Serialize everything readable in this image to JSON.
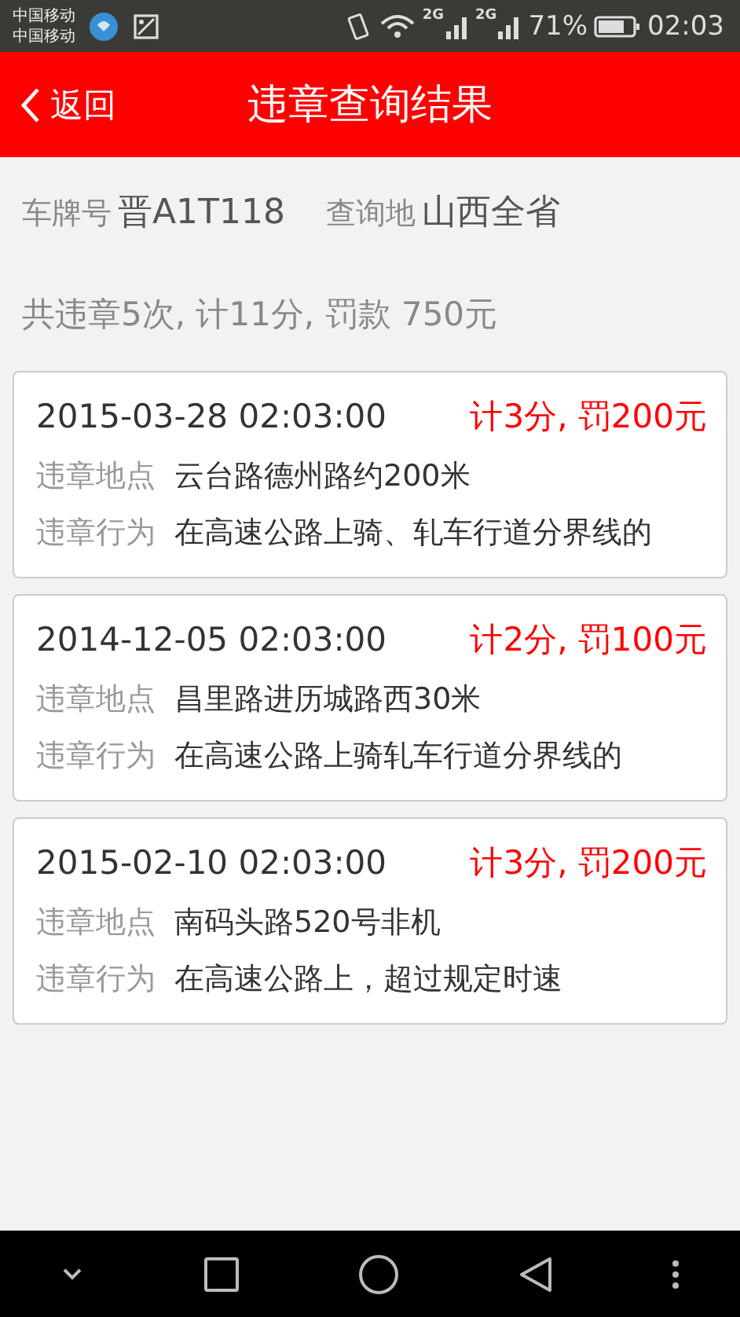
{
  "status_bar": {
    "carriers": [
      "中国移动",
      "中国移动"
    ],
    "network_1": "2G",
    "network_2": "2G",
    "battery": "71%",
    "time": "02:03"
  },
  "header": {
    "back": "返回",
    "title": "违章查询结果"
  },
  "query": {
    "plate_label": "车牌号",
    "plate": "晋A1T118",
    "region_label": "查询地",
    "region": "山西全省"
  },
  "summary": "共违章5次, 计11分, 罚款 750元",
  "records": [
    {
      "time": "2015-03-28 02:03:00",
      "penalty": "计3分, 罚200元",
      "location_label": "违章地点",
      "location": "云台路德州路约200米",
      "action_label": "违章行为",
      "action": "在高速公路上骑、轧车行道分界线的"
    },
    {
      "time": "2014-12-05 02:03:00",
      "penalty": "计2分, 罚100元",
      "location_label": "违章地点",
      "location": "昌里路进历城路西30米",
      "action_label": "违章行为",
      "action": "在高速公路上骑轧车行道分界线的"
    },
    {
      "time": "2015-02-10 02:03:00",
      "penalty": "计3分, 罚200元",
      "location_label": "违章地点",
      "location": "南码头路520号非机",
      "action_label": "违章行为",
      "action": "在高速公路上，超过规定时速"
    }
  ]
}
